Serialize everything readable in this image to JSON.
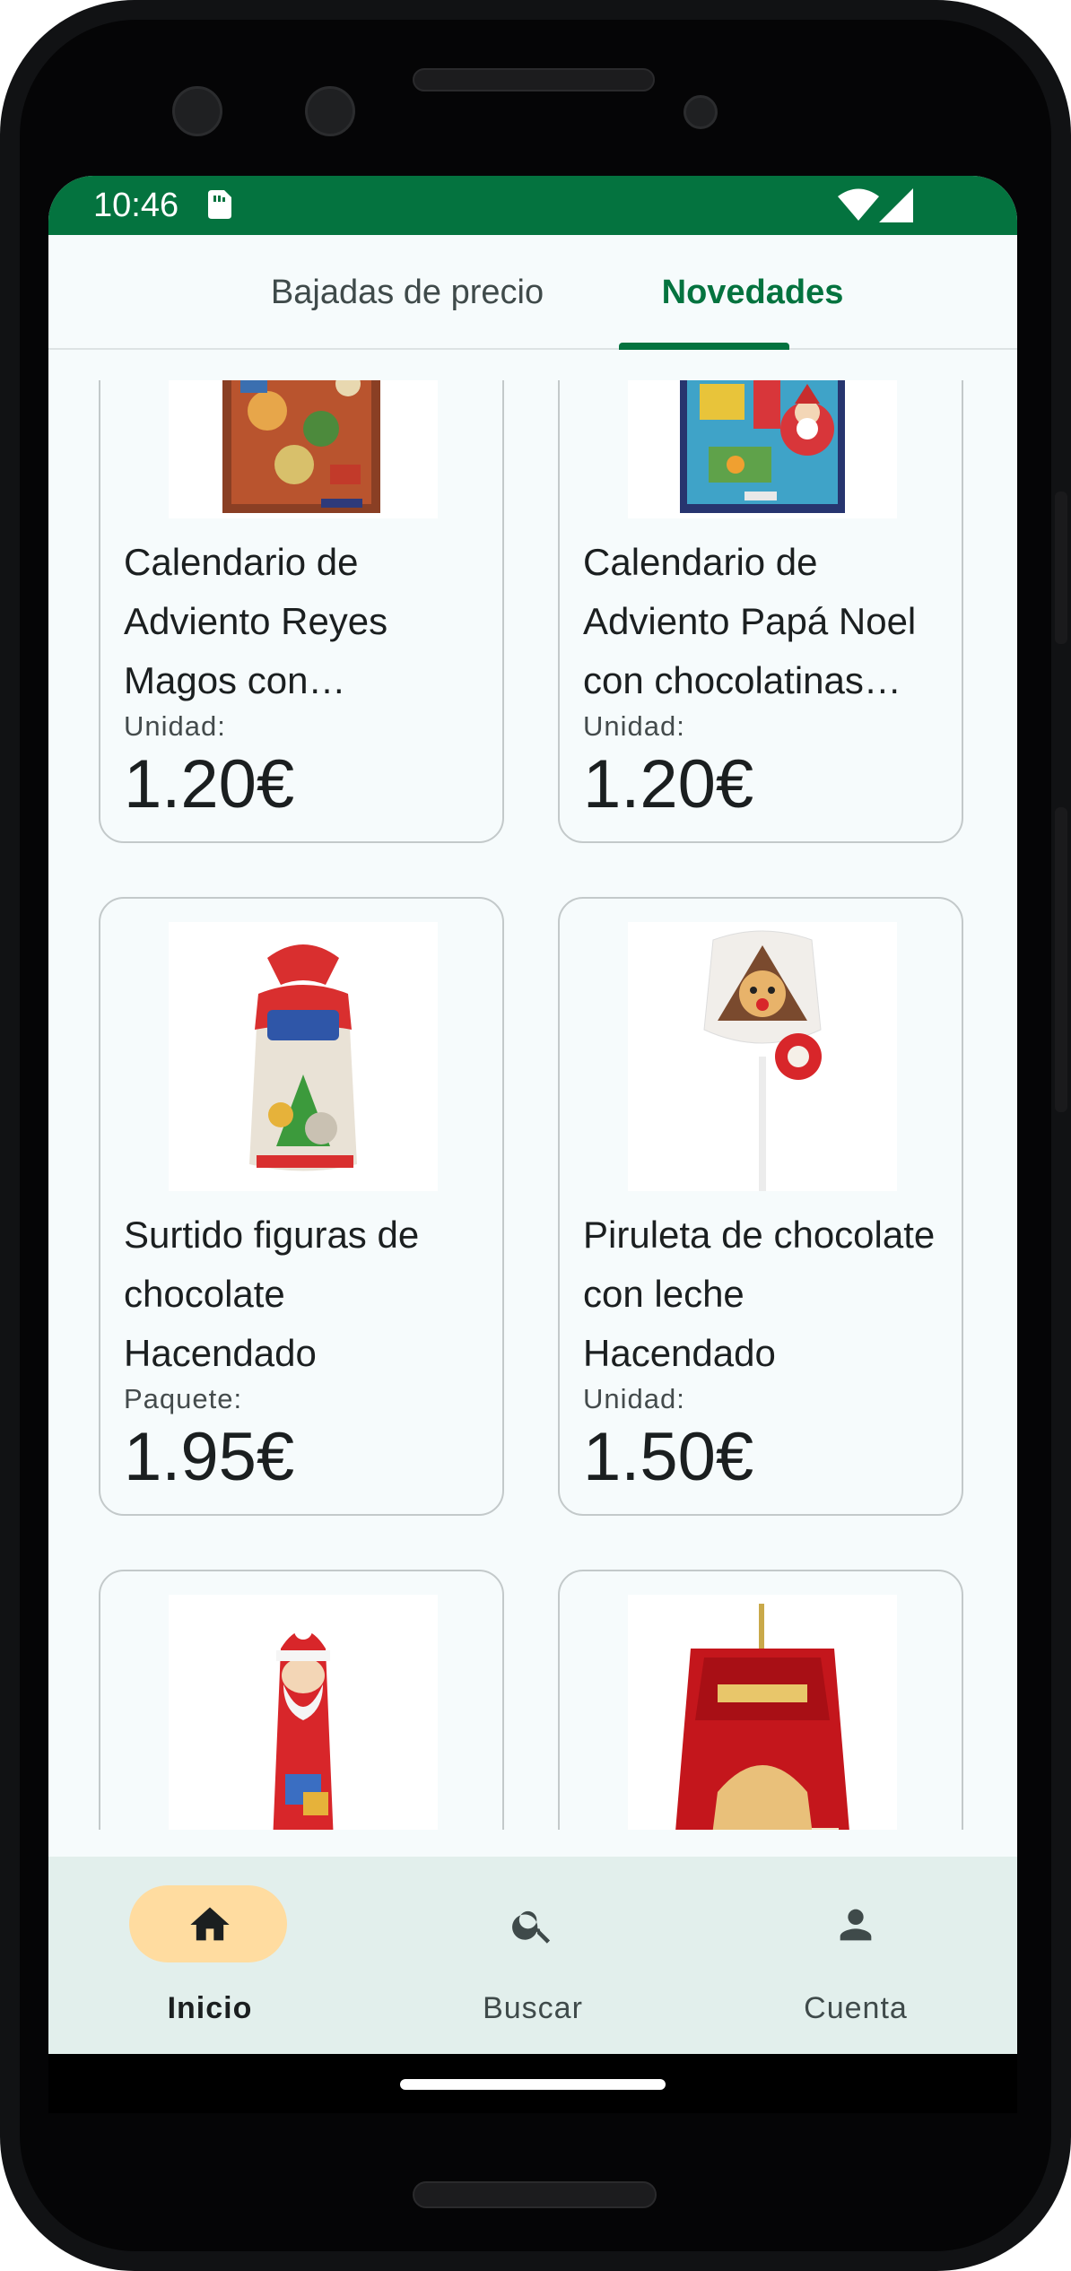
{
  "status": {
    "time": "10:46"
  },
  "tabs": [
    {
      "label": "Bajadas de precio",
      "selected": false
    },
    {
      "label": "Novedades",
      "selected": true
    }
  ],
  "products": [
    {
      "name": "Calendario de Adviento Reyes Magos con chocolatinas Hacendado",
      "unit": "Unidad:",
      "price": "1.20€",
      "image": "advent-calendar-three-kings-image"
    },
    {
      "name": "Calendario de Adviento Papá Noel con chocolatinas Hacendado",
      "unit": "Unidad:",
      "price": "1.20€",
      "image": "advent-calendar-santa-image"
    },
    {
      "name": "Surtido figuras de chocolate Hacendado",
      "unit": "Paquete:",
      "price": "1.95€",
      "image": "chocolate-figures-bag-image"
    },
    {
      "name": "Piruleta de chocolate con leche Hacendado",
      "unit": "Unidad:",
      "price": "1.50€",
      "image": "reindeer-chocolate-lollipop-image"
    },
    {
      "name": "",
      "unit": "",
      "price": "",
      "image": "chocolate-santa-figure-image"
    },
    {
      "name": "",
      "unit": "",
      "price": "",
      "image": "balocco-pandoro-image"
    }
  ],
  "bottom_nav": [
    {
      "label": "Inicio",
      "icon": "home-icon",
      "active": true
    },
    {
      "label": "Buscar",
      "icon": "search-icon",
      "active": false
    },
    {
      "label": "Cuenta",
      "icon": "account-icon",
      "active": false
    }
  ],
  "colors": {
    "accent": "#04733f",
    "nav_pill": "#ffdca0",
    "nav_bg": "#e2efec",
    "background": "#f6fbfc"
  }
}
